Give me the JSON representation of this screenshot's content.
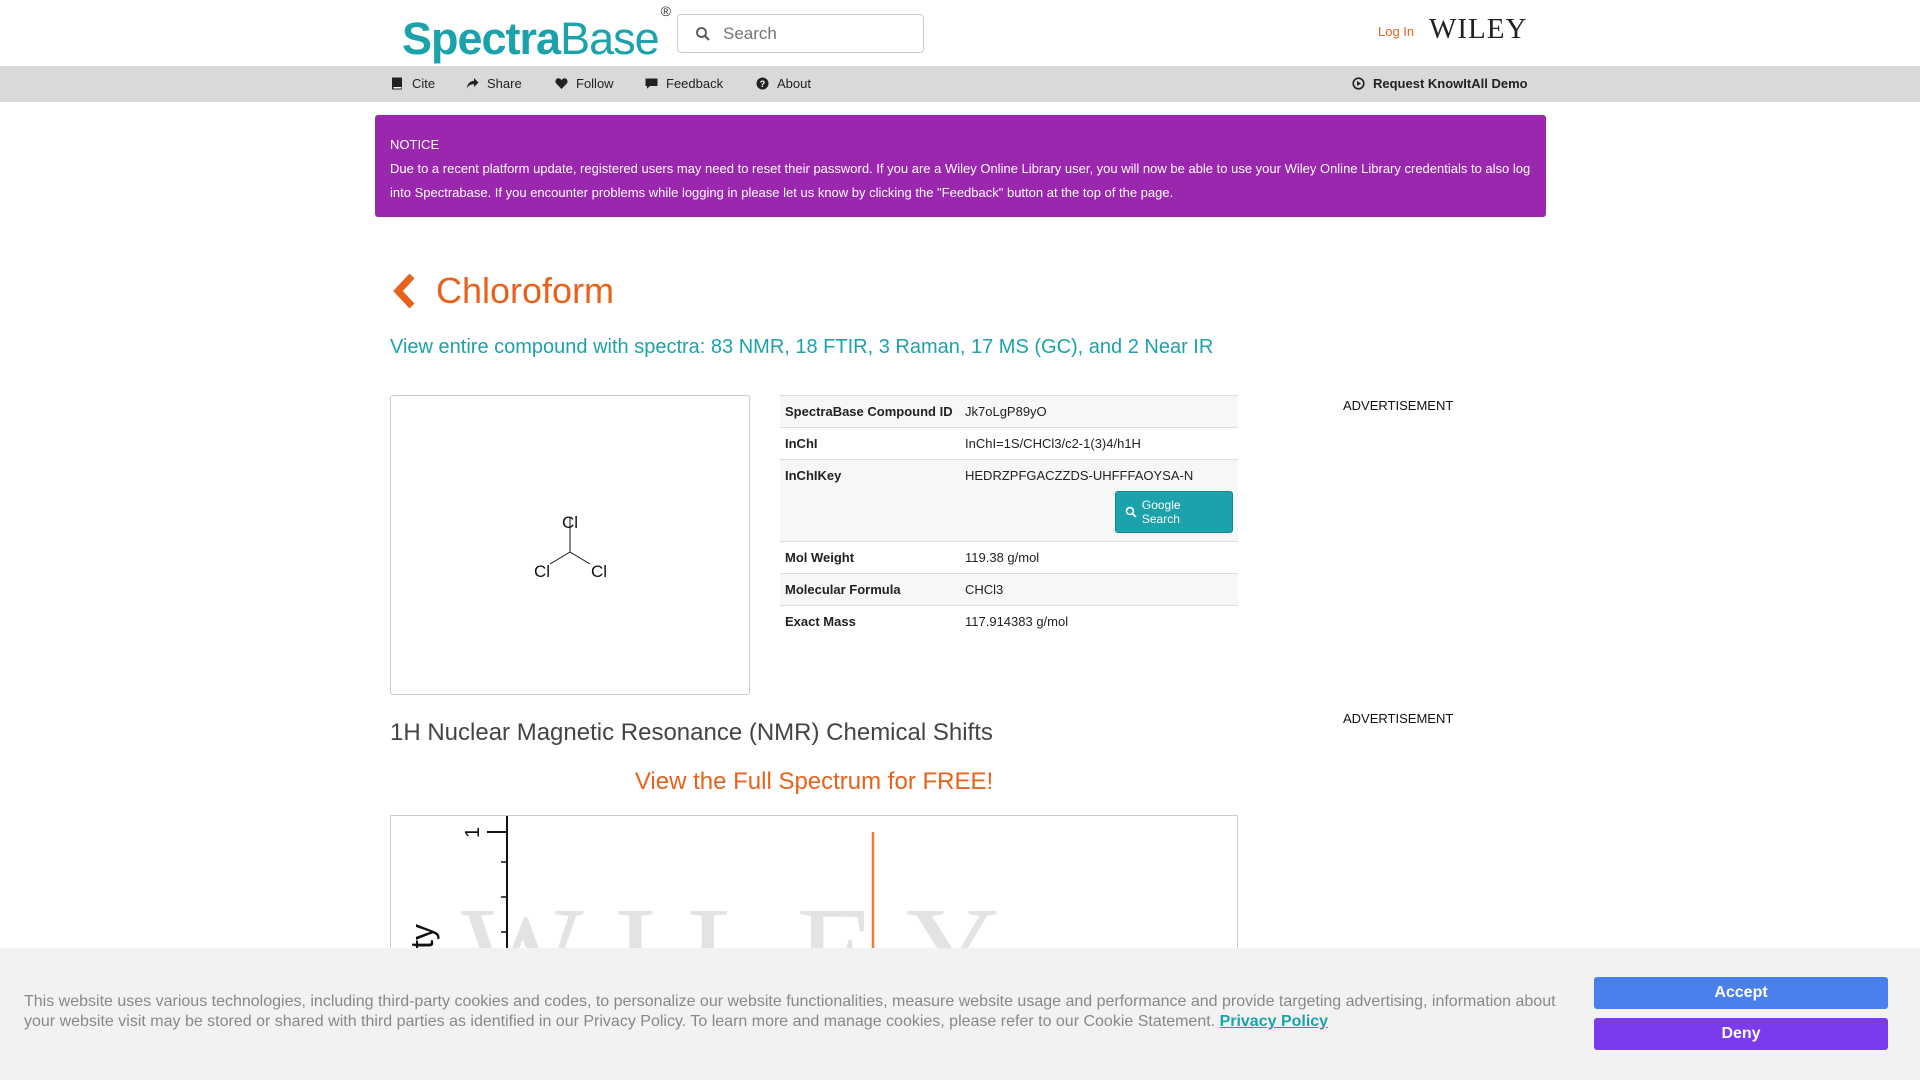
{
  "header": {
    "logo_part1": "Spectra",
    "logo_part2": "Base",
    "logo_reg": "®",
    "search_placeholder": "Search",
    "login_label": "Log In",
    "publisher": "WILEY"
  },
  "nav": {
    "cite": "Cite",
    "share": "Share",
    "follow": "Follow",
    "feedback": "Feedback",
    "about": "About",
    "demo": "Request KnowItAll Demo"
  },
  "notice": {
    "heading": "NOTICE",
    "body": "Due to a recent platform update, registered users may need to reset their password. If you are a Wiley Online Library user, you will now be able to use your Wiley Online Library credentials to also log into Spectrabase. If you encounter problems while logging in please let us know by clicking the \"Feedback\" button at the top of the page."
  },
  "compound": {
    "name": "Chloroform",
    "view_link": "View entire compound with spectra: 83 NMR, 18 FTIR, 3 Raman, 17 MS (GC), and 2 Near IR",
    "structure_atoms": [
      "Cl",
      "Cl",
      "Cl"
    ],
    "properties": [
      {
        "key": "SpectraBase Compound ID",
        "value": "Jk7oLgP89yO"
      },
      {
        "key": "InChI",
        "value": "InChI=1S/CHCl3/c2-1(3)4/h1H"
      },
      {
        "key": "InChIKey",
        "value": "HEDRZPFGACZZDS-UHFFFAOYSA-N"
      },
      {
        "key": "Mol Weight",
        "value": "119.38 g/mol"
      },
      {
        "key": "Molecular Formula",
        "value": "CHCl3"
      },
      {
        "key": "Exact Mass",
        "value": "117.914383 g/mol"
      }
    ],
    "google_search_label": "Google Search"
  },
  "ads": {
    "label_1": "ADVERTISEMENT",
    "label_2": "ADVERTISEMENT"
  },
  "nmr": {
    "heading": "1H Nuclear Magnetic Resonance (NMR) Chemical Shifts",
    "full_spectrum_link": "View the Full Spectrum for FREE!",
    "y_tick": "1",
    "y_label_partial": "ity",
    "watermark": "WILEY"
  },
  "cookie": {
    "text": "This website uses various technologies, including third-party cookies and codes, to personalize our website functionalities, measure website usage and performance and provide targeting advertising, information about your website visit may be stored or shared with third parties as identified in our Privacy Policy. To learn more and manage cookies, please refer to our Cookie Statement.",
    "privacy_link": "Privacy Policy",
    "accept": "Accept",
    "deny": "Deny"
  },
  "colors": {
    "brand_teal": "#1ba2ab",
    "accent_orange": "#e8621c",
    "notice_purple": "#9b27af",
    "accept_blue": "#4a80ec",
    "deny_purple": "#7c3aed"
  }
}
